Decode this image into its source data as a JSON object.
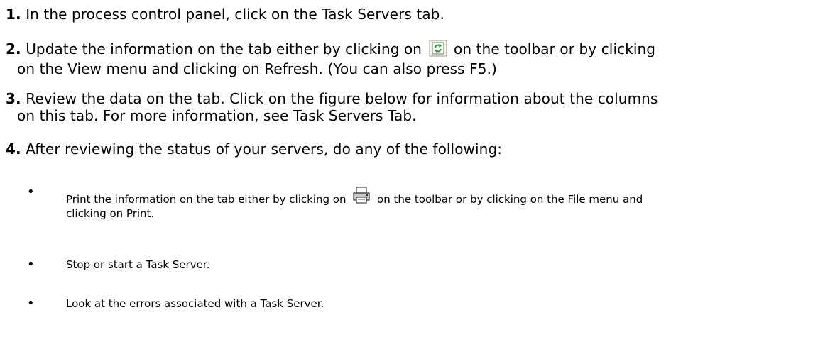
{
  "steps": [
    {
      "num": "1.",
      "text": "In the process control panel, click on the Task Servers tab."
    },
    {
      "num": "2.",
      "text_before_icon": "Update the information on the tab either by clicking on",
      "icon": "refresh-icon",
      "text_after_icon": "on the toolbar or by clicking",
      "continuation": "on the View menu and clicking on Refresh. (You can also press F5.)"
    },
    {
      "num": "3.",
      "text": "Review the data on the tab. Click on the figure below for information about the columns",
      "continuation": "on this tab. For more information, see Task Servers Tab."
    },
    {
      "num": "4.",
      "text": "After reviewing the status of your servers, do any of the following:"
    }
  ],
  "bullets": [
    {
      "text_before_icon": "Print the information on the tab either by clicking on",
      "icon": "printer-icon",
      "text_after_icon": "on the toolbar or by clicking on the File menu and",
      "continuation": "clicking on Print."
    },
    {
      "text": "Stop or start a Task Server."
    },
    {
      "text": "Look at the errors associated with a Task Server."
    }
  ],
  "colors": {
    "text": "#000000",
    "icon_green": "#2e9a3a",
    "icon_bg": "#f4f4e4"
  }
}
